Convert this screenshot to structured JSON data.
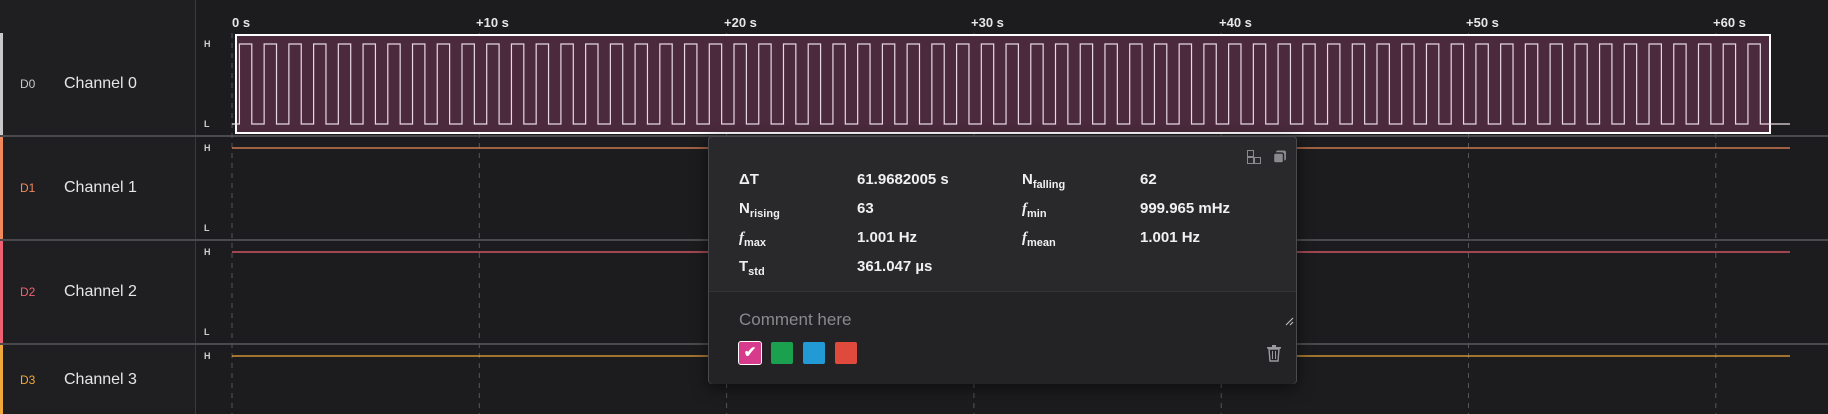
{
  "timeline": {
    "ticks": [
      "0 s",
      "+10 s",
      "+20 s",
      "+30 s",
      "+40 s",
      "+50 s",
      "+60 s"
    ]
  },
  "channels": [
    {
      "id": "D0",
      "name": "Channel 0",
      "color": "#c8c8c8",
      "high_label": "H",
      "low_label": "L"
    },
    {
      "id": "D1",
      "name": "Channel 1",
      "color": "#f0885a",
      "high_label": "H",
      "low_label": "L"
    },
    {
      "id": "D2",
      "name": "Channel 2",
      "color": "#f06070",
      "high_label": "H",
      "low_label": "L"
    },
    {
      "id": "D3",
      "name": "Channel 3",
      "color": "#f0a83a",
      "high_label": "H",
      "low_label": ""
    }
  ],
  "selection": {
    "stats": [
      {
        "label": "ΔT",
        "value": "61.9682005 s"
      },
      {
        "label_main": "N",
        "label_sub": "falling",
        "value": "62"
      },
      {
        "label_main": "N",
        "label_sub": "rising",
        "value": "63"
      },
      {
        "label_main": "f",
        "label_sub": "min",
        "value": "999.965 mHz"
      },
      {
        "label_main": "f",
        "label_sub": "max",
        "value": "1.001 Hz"
      },
      {
        "label_main": "f",
        "label_sub": "mean",
        "value": "1.001 Hz"
      },
      {
        "label_main": "T",
        "label_sub": "std",
        "value": "361.047 µs"
      }
    ],
    "comment_placeholder": "Comment here",
    "colors": [
      "#d63b8c",
      "#1aa04e",
      "#229ad6",
      "#e04a3c"
    ],
    "selected_color_index": 0
  }
}
